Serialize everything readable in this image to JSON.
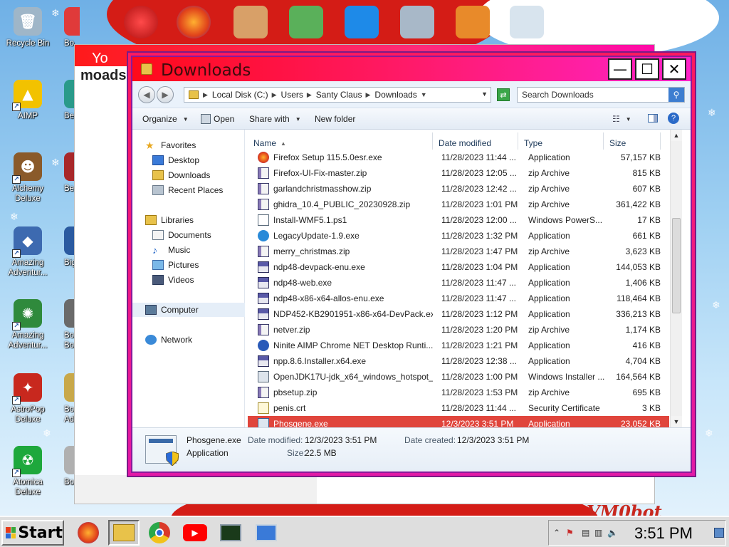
{
  "desktop": {
    "icons_left": [
      {
        "label": "Recycle Bin",
        "color": "#9fb6c8",
        "glyph": "🗑"
      },
      {
        "label": "AIMP",
        "color": "#f2c200",
        "glyph": "▲"
      },
      {
        "label": "Alchemy Deluxe",
        "color": "#8a5a2a",
        "glyph": "☻"
      },
      {
        "label": "Amazing Adventur...",
        "color": "#3d6ab0",
        "glyph": "◆"
      },
      {
        "label": "Amazing Adventur...",
        "color": "#2f8a3c",
        "glyph": "✺"
      },
      {
        "label": "AstroPop Deluxe",
        "color": "#c8281e",
        "glyph": "✦"
      },
      {
        "label": "Atomica Deluxe",
        "color": "#1ea83c",
        "glyph": "☢"
      }
    ],
    "icons_second_col": [
      {
        "label": "Bo",
        "color": "#e03a3a"
      },
      {
        "label": "Be",
        "color": "#2a9a8a"
      },
      {
        "label": "Be",
        "color": "#a8282a"
      },
      {
        "label": "Big",
        "color": "#2a5aa0"
      },
      {
        "label": "Bo Bo",
        "color": "#6a6a6a"
      },
      {
        "label": "Bo Adv",
        "color": "#c8a84a"
      },
      {
        "label": "Bo",
        "color": "#b0b0b0"
      }
    ],
    "watermark": "VM0bot"
  },
  "bg_window": {
    "tab_fragment": "Yo",
    "text_fragment": "moads"
  },
  "explorer": {
    "title": "Downloads",
    "buttons": {
      "minimize": "—",
      "maximize": "☐",
      "close": "✕"
    },
    "address": {
      "crumbs": [
        "Local Disk (C:)",
        "Users",
        "Santy Claus",
        "Downloads"
      ],
      "search_placeholder": "Search Downloads"
    },
    "toolbar": {
      "organize": "Organize",
      "open": "Open",
      "share_with": "Share with",
      "new_folder": "New folder"
    },
    "nav": {
      "favorites": "Favorites",
      "desktop": "Desktop",
      "downloads": "Downloads",
      "recent_places": "Recent Places",
      "libraries": "Libraries",
      "documents": "Documents",
      "music": "Music",
      "pictures": "Pictures",
      "videos": "Videos",
      "computer": "Computer",
      "network": "Network"
    },
    "columns": {
      "name": "Name",
      "date": "Date modified",
      "type": "Type",
      "size": "Size"
    },
    "files": [
      {
        "name": "Firefox Setup 115.5.0esr.exe",
        "date": "11/28/2023 11:44 ...",
        "type": "Application",
        "size": "57,157 KB",
        "icon": "firefox"
      },
      {
        "name": "Firefox-UI-Fix-master.zip",
        "date": "11/28/2023 12:05 ...",
        "type": "zip Archive",
        "size": "815 KB",
        "icon": "zip"
      },
      {
        "name": "garlandchristmasshow.zip",
        "date": "11/28/2023 12:42 ...",
        "type": "zip Archive",
        "size": "607 KB",
        "icon": "zip"
      },
      {
        "name": "ghidra_10.4_PUBLIC_20230928.zip",
        "date": "11/28/2023 1:01 PM",
        "type": "zip Archive",
        "size": "361,422 KB",
        "icon": "zip"
      },
      {
        "name": "Install-WMF5.1.ps1",
        "date": "11/28/2023 12:00 ...",
        "type": "Windows PowerS...",
        "size": "17 KB",
        "icon": "doc"
      },
      {
        "name": "LegacyUpdate-1.9.exe",
        "date": "11/28/2023 1:32 PM",
        "type": "Application",
        "size": "661 KB",
        "icon": "update"
      },
      {
        "name": "merry_christmas.zip",
        "date": "11/28/2023 1:47 PM",
        "type": "zip Archive",
        "size": "3,623 KB",
        "icon": "zip"
      },
      {
        "name": "ndp48-devpack-enu.exe",
        "date": "11/28/2023 1:04 PM",
        "type": "Application",
        "size": "144,053 KB",
        "icon": "setup"
      },
      {
        "name": "ndp48-web.exe",
        "date": "11/28/2023 11:47 ...",
        "type": "Application",
        "size": "1,406 KB",
        "icon": "setup"
      },
      {
        "name": "ndp48-x86-x64-allos-enu.exe",
        "date": "11/28/2023 11:47 ...",
        "type": "Application",
        "size": "118,464 KB",
        "icon": "setup"
      },
      {
        "name": "NDP452-KB2901951-x86-x64-DevPack.exe",
        "date": "11/28/2023 1:12 PM",
        "type": "Application",
        "size": "336,213 KB",
        "icon": "setup"
      },
      {
        "name": "netver.zip",
        "date": "11/28/2023 1:20 PM",
        "type": "zip Archive",
        "size": "1,174 KB",
        "icon": "zip"
      },
      {
        "name": "Ninite AIMP Chrome NET Desktop Runti...",
        "date": "11/28/2023 1:21 PM",
        "type": "Application",
        "size": "416 KB",
        "icon": "ninite"
      },
      {
        "name": "npp.8.6.Installer.x64.exe",
        "date": "11/28/2023 12:38 ...",
        "type": "Application",
        "size": "4,704 KB",
        "icon": "setup"
      },
      {
        "name": "OpenJDK17U-jdk_x64_windows_hotspot_...",
        "date": "11/28/2023 1:00 PM",
        "type": "Windows Installer ...",
        "size": "164,564 KB",
        "icon": "msi"
      },
      {
        "name": "pbsetup.zip",
        "date": "11/28/2023 1:53 PM",
        "type": "zip Archive",
        "size": "695 KB",
        "icon": "zip"
      },
      {
        "name": "penis.crt",
        "date": "11/28/2023 11:44 ...",
        "type": "Security Certificate",
        "size": "3 KB",
        "icon": "cert"
      },
      {
        "name": "Phosgene.exe",
        "date": "12/3/2023 3:51 PM",
        "type": "Application",
        "size": "23,052 KB",
        "icon": "exe",
        "selected": true
      }
    ],
    "details": {
      "name": "Phosgene.exe",
      "type": "Application",
      "date_modified_label": "Date modified:",
      "date_modified": "12/3/2023 3:51 PM",
      "date_created_label": "Date created:",
      "date_created": "12/3/2023 3:51 PM",
      "size_label": "Size:",
      "size": "22.5 MB"
    }
  },
  "taskbar": {
    "start_label": "Start",
    "clock": "3:51 PM",
    "tray_expand": "⌃"
  }
}
